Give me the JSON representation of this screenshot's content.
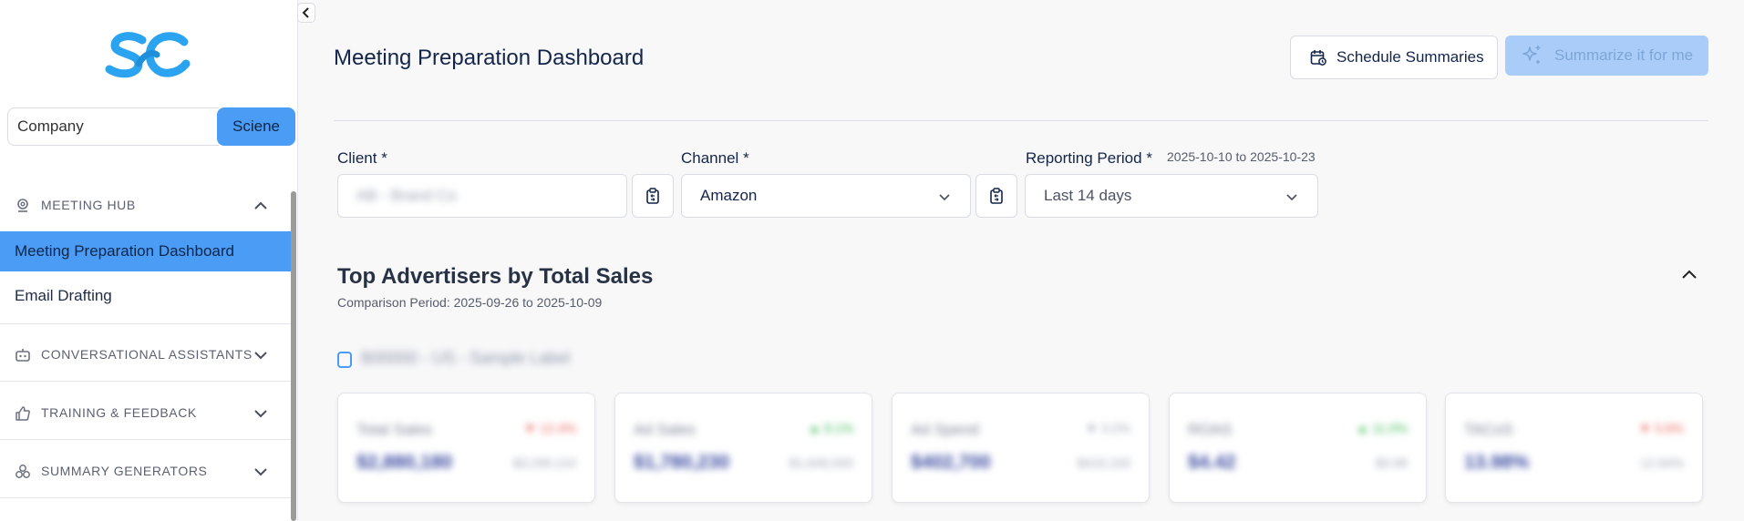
{
  "sidebar": {
    "logo_text": "SC",
    "search": {
      "value": "Company",
      "button_label": "Sciene"
    },
    "sections": [
      {
        "label": "MEETING HUB",
        "icon": "pin-icon",
        "expanded": true,
        "items": [
          {
            "label": "Meeting Preparation Dashboard",
            "active": true
          },
          {
            "label": "Email Drafting",
            "active": false
          }
        ]
      },
      {
        "label": "CONVERSATIONAL ASSISTANTS",
        "icon": "robot-icon",
        "expanded": false
      },
      {
        "label": "TRAINING & FEEDBACK",
        "icon": "thumbs-up-icon",
        "expanded": false
      },
      {
        "label": "SUMMARY GENERATORS",
        "icon": "cubes-icon",
        "expanded": false
      }
    ]
  },
  "header": {
    "title": "Meeting Preparation Dashboard",
    "schedule_label": "Schedule Summaries",
    "summarize_label": "Summarize it for me"
  },
  "filters": {
    "client": {
      "label": "Client",
      "required_mark": "*",
      "value": "AB - Brand Co"
    },
    "channel": {
      "label": "Channel",
      "required_mark": "*",
      "value": "Amazon"
    },
    "period": {
      "label": "Reporting Period",
      "required_mark": "*",
      "range": "2025-10-10 to 2025-10-23",
      "value": "Last 14 days"
    }
  },
  "top_advertisers": {
    "title": "Top Advertisers by Total Sales",
    "comparison": "Comparison Period: 2025-09-26 to 2025-10-09",
    "advertiser_name": "B00000 - US - Sample Label",
    "cards": [
      {
        "label": "Total Sales",
        "delta": "▼ 12.4%",
        "value": "$2,880,180",
        "prev": "$3,290,110"
      },
      {
        "label": "Ad Sales",
        "delta": "▲ 8.1%",
        "value": "$1,780,230",
        "prev": "$1,646,000"
      },
      {
        "label": "Ad Spend",
        "delta": "▼ 3.2%",
        "value": "$402,700",
        "prev": "$416,100"
      },
      {
        "label": "ROAS",
        "delta": "▲ 11.0%",
        "value": "$4.42",
        "prev": "$3.98"
      },
      {
        "label": "TACoS",
        "delta": "▼ 5.6%",
        "value": "13.98%",
        "prev": "12.64%"
      }
    ]
  },
  "colors": {
    "accent": "#4a9cf5",
    "title": "#13254a",
    "muted": "#a9cdf8",
    "up": "#2fb64a",
    "down": "#e8594f"
  }
}
